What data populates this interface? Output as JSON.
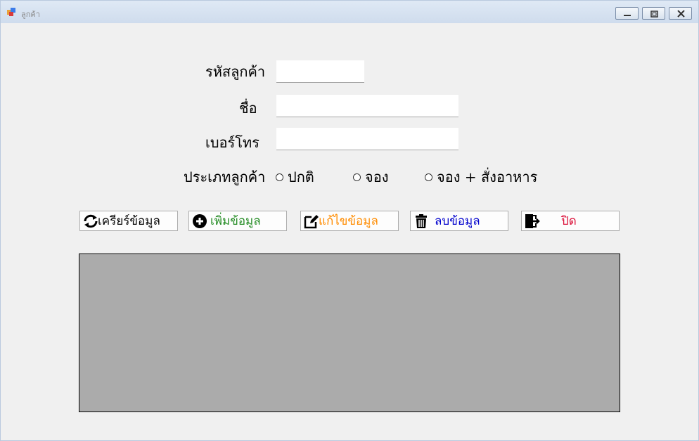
{
  "window": {
    "title": "ลูกค้า"
  },
  "form": {
    "customer_id_label": "รหัสลูกค้า",
    "customer_id_value": "",
    "name_label": "ชื่อ",
    "name_value": "",
    "phone_label": "เบอร์โทร",
    "phone_value": "",
    "customer_type_label": "ประเภทลูกค้า",
    "customer_type_options": [
      "ปกติ",
      "จอง",
      "จอง + สั่งอาหาร"
    ]
  },
  "buttons": {
    "refresh": {
      "label": "เครียร์ข้อมูล",
      "color": "#000000"
    },
    "add": {
      "label": "เพิ่มข้อมูล",
      "color": "#228b22"
    },
    "edit": {
      "label": "แก้ไขข้อมูล",
      "color": "#ff8c00"
    },
    "delete": {
      "label": "ลบข้อมูล",
      "color": "#0000cd"
    },
    "close": {
      "label": "ปิด",
      "color": "#dc143c"
    }
  },
  "grid": {
    "background": "#ababab"
  }
}
